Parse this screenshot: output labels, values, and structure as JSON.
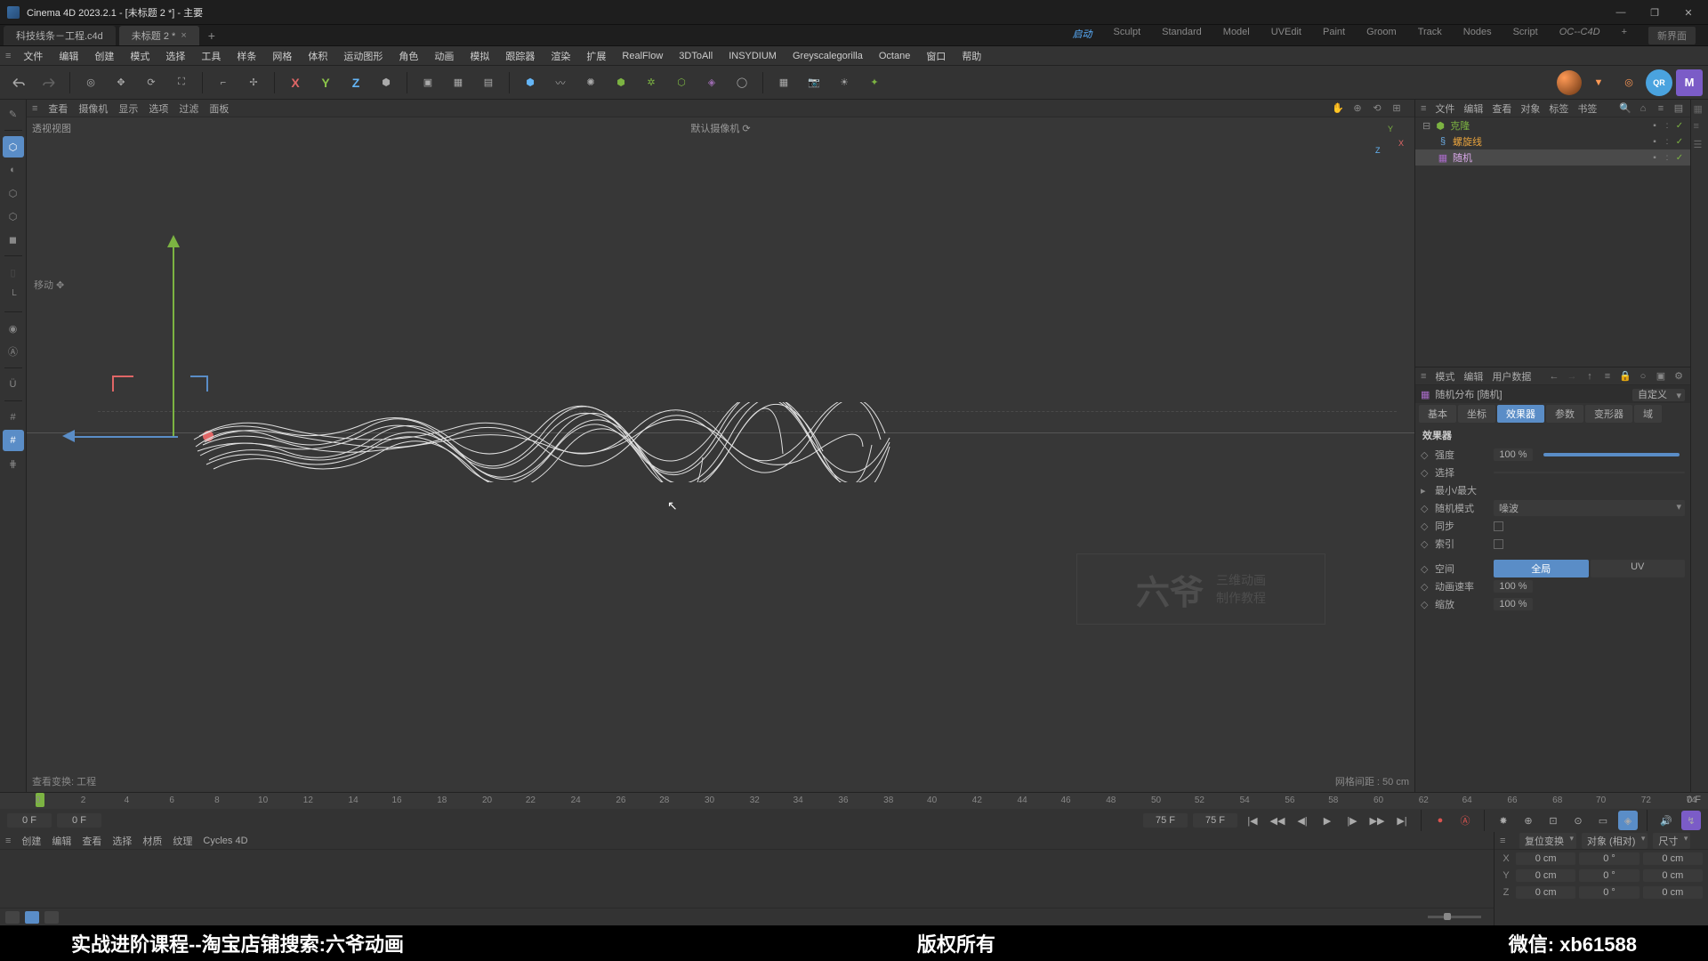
{
  "window": {
    "title": "Cinema 4D 2023.2.1 - [未标题 2 *] - 主要",
    "min": "—",
    "max": "❐",
    "close": "✕"
  },
  "docTabs": {
    "t1": "科技线条－工程.c4d",
    "t2": "未标题 2 *",
    "close": "×",
    "add": "+"
  },
  "layouts": {
    "l0": "启动",
    "l1": "Sculpt",
    "l2": "Standard",
    "l3": "Model",
    "l4": "UVEdit",
    "l5": "Paint",
    "l6": "Groom",
    "l7": "Track",
    "l8": "Nodes",
    "l9": "Script",
    "l10": "OC--C4D",
    "add": "+",
    "new": "新界面"
  },
  "menu": {
    "m0": "文件",
    "m1": "编辑",
    "m2": "创建",
    "m3": "模式",
    "m4": "选择",
    "m5": "工具",
    "m6": "样条",
    "m7": "网格",
    "m8": "体积",
    "m9": "运动图形",
    "m10": "角色",
    "m11": "动画",
    "m12": "模拟",
    "m13": "跟踪器",
    "m14": "渲染",
    "m15": "扩展",
    "m16": "RealFlow",
    "m17": "3DToAll",
    "m18": "INSYDIUM",
    "m19": "Greyscalegorilla",
    "m20": "Octane",
    "m21": "窗口",
    "m22": "帮助"
  },
  "axes": {
    "x": "X",
    "y": "Y",
    "z": "Z"
  },
  "vpMenu": {
    "m0": "查看",
    "m1": "摄像机",
    "m2": "显示",
    "m3": "选项",
    "m4": "过滤",
    "m5": "面板"
  },
  "viewport": {
    "persp": "透视视图",
    "cam": "默认摄像机 ⟳",
    "tool": "移动 ✥",
    "grid": "网格间距 : 50 cm",
    "view": "查看变换: 工程"
  },
  "vpAxis": {
    "x": "X",
    "y": "Y",
    "z": "Z"
  },
  "watermark": {
    "big": "六爷",
    "s1": "三维动画",
    "s2": "制作教程"
  },
  "objMenu": {
    "m0": "文件",
    "m1": "编辑",
    "m2": "查看",
    "m3": "对象",
    "m4": "标签",
    "m5": "书签"
  },
  "tree": {
    "o1": "克隆",
    "o2": "螺旋线",
    "o3": "随机"
  },
  "attrMenu": {
    "m0": "模式",
    "m1": "编辑",
    "m2": "用户数据"
  },
  "attr": {
    "title": "随机分布 [随机]",
    "custom": "自定义",
    "tabs": {
      "t0": "基本",
      "t1": "坐标",
      "t2": "效果器",
      "t3": "参数",
      "t4": "变形器",
      "t5": "域"
    },
    "section": "效果器",
    "strength_l": "强度",
    "strength_v": "100 %",
    "select_l": "选择",
    "minmax_l": "最小/最大",
    "mode_l": "随机模式",
    "mode_v": "噪波",
    "sync_l": "同步",
    "index_l": "索引",
    "space_l": "空间",
    "space_a": "全局",
    "space_b": "UV",
    "speed_l": "动画速率",
    "speed_v": "100 %",
    "scale_l": "缩放",
    "scale_v": "100 %"
  },
  "timeline": {
    "startF": "0 F",
    "startF2": "0 F",
    "endF": "75 F",
    "endF2": "75 F",
    "rangeEnd": "0 F",
    "ticks": {
      "t0": "0",
      "t2": "2",
      "t4": "4",
      "t6": "6",
      "t8": "8",
      "t10": "10",
      "t12": "12",
      "t14": "14",
      "t16": "16",
      "t18": "18",
      "t20": "20",
      "t22": "22",
      "t24": "24",
      "t26": "26",
      "t28": "28",
      "t30": "30",
      "t32": "32",
      "t34": "34",
      "t36": "36",
      "t38": "38",
      "t40": "40",
      "t42": "42",
      "t44": "44",
      "t46": "46",
      "t48": "48",
      "t50": "50",
      "t52": "52",
      "t54": "54",
      "t56": "56",
      "t58": "58",
      "t60": "60",
      "t62": "62",
      "t64": "64",
      "t66": "66",
      "t68": "68",
      "t70": "70",
      "t72": "72",
      "t74": "74"
    }
  },
  "matMenu": {
    "m0": "创建",
    "m1": "编辑",
    "m2": "查看",
    "m3": "选择",
    "m4": "材质",
    "m5": "纹理",
    "m6": "Cycles 4D"
  },
  "coord": {
    "hdr_reset": "复位变换",
    "hdr_obj": "对象 (相对)",
    "hdr_size": "尺寸",
    "X": "X",
    "Y": "Y",
    "Z": "Z",
    "px": "0 cm",
    "py": "0 cm",
    "pz": "0 cm",
    "rx": "0 °",
    "ry": "0 °",
    "rz": "0 °",
    "sx": "0 cm",
    "sy": "0 cm",
    "sz": "0 cm"
  },
  "footer": {
    "l": "实战进阶课程--淘宝店铺搜索:六爷动画",
    "c": "版权所有",
    "r": "微信: xb61588"
  }
}
